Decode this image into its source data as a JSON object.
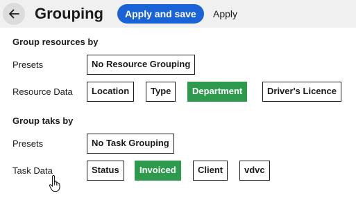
{
  "header": {
    "title": "Grouping",
    "apply_save_label": "Apply and save",
    "apply_label": "Apply"
  },
  "resources": {
    "section_title": "Group resources by",
    "presets_label": "Presets",
    "data_label": "Resource Data",
    "presets": [
      {
        "label": "No Resource Grouping",
        "selected": false
      }
    ],
    "data": [
      {
        "label": "Location",
        "selected": false
      },
      {
        "label": "Type",
        "selected": false
      },
      {
        "label": "Department",
        "selected": true
      },
      {
        "label": "Driver's Licence",
        "selected": false
      }
    ]
  },
  "tasks": {
    "section_title": "Group taks by",
    "presets_label": "Presets",
    "data_label": "Task Data",
    "presets": [
      {
        "label": "No Task Grouping",
        "selected": false
      }
    ],
    "data": [
      {
        "label": "Status",
        "selected": false
      },
      {
        "label": "Invoiced",
        "selected": true
      },
      {
        "label": "Client",
        "selected": false
      },
      {
        "label": "vdvc",
        "selected": false
      }
    ]
  },
  "colors": {
    "primary": "#1a63d6",
    "selected": "#2e9a4d",
    "header_bg": "#f0f0f0"
  }
}
